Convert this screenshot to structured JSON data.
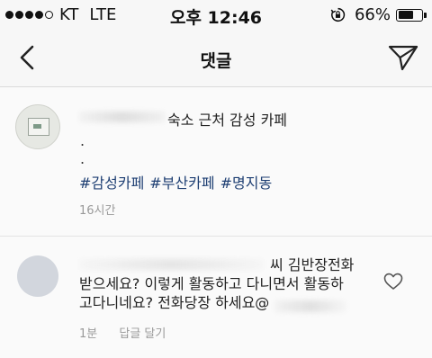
{
  "status_bar": {
    "carrier": "KT",
    "network": "LTE",
    "time": "오후 12:46",
    "battery_percent": "66%",
    "battery_level": 0.66,
    "signal_bars": 4,
    "signal_total": 5
  },
  "nav": {
    "title": "댓글",
    "back_icon": "chevron-left-icon",
    "share_icon": "paper-plane-icon"
  },
  "caption": {
    "text": "숙소 근처 감성 카페",
    "dots": [
      ".",
      "."
    ],
    "hashtags": [
      "#감성카페",
      "#부산카페",
      "#명지동"
    ],
    "time": "16시간"
  },
  "comment": {
    "line1": "씨 김반장전화",
    "line2": "받으세요? 이렇게 활동하고 다니면서 활동하",
    "line3": "고다니네요? 전화당장 하세요@",
    "time": "1분",
    "reply_label": "답글 달기",
    "heart_icon": "heart-outline-icon"
  },
  "colors": {
    "hashtag": "#1e3f73",
    "meta": "#9a9a9a"
  }
}
